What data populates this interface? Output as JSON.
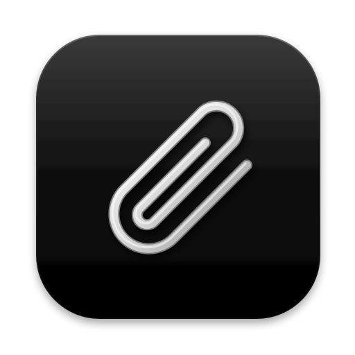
{
  "icon": {
    "name": "paperclip-app-icon",
    "glyph": "paperclip-icon",
    "colors": {
      "page_background": "#ffffff",
      "tile_top": "#3a3a3a",
      "tile_mid": "#121212",
      "tile_bottom": "#000000",
      "clip_highlight": "#ffffff",
      "clip_mid": "#d8d8d8",
      "clip_shade": "#8e8e8e"
    }
  }
}
